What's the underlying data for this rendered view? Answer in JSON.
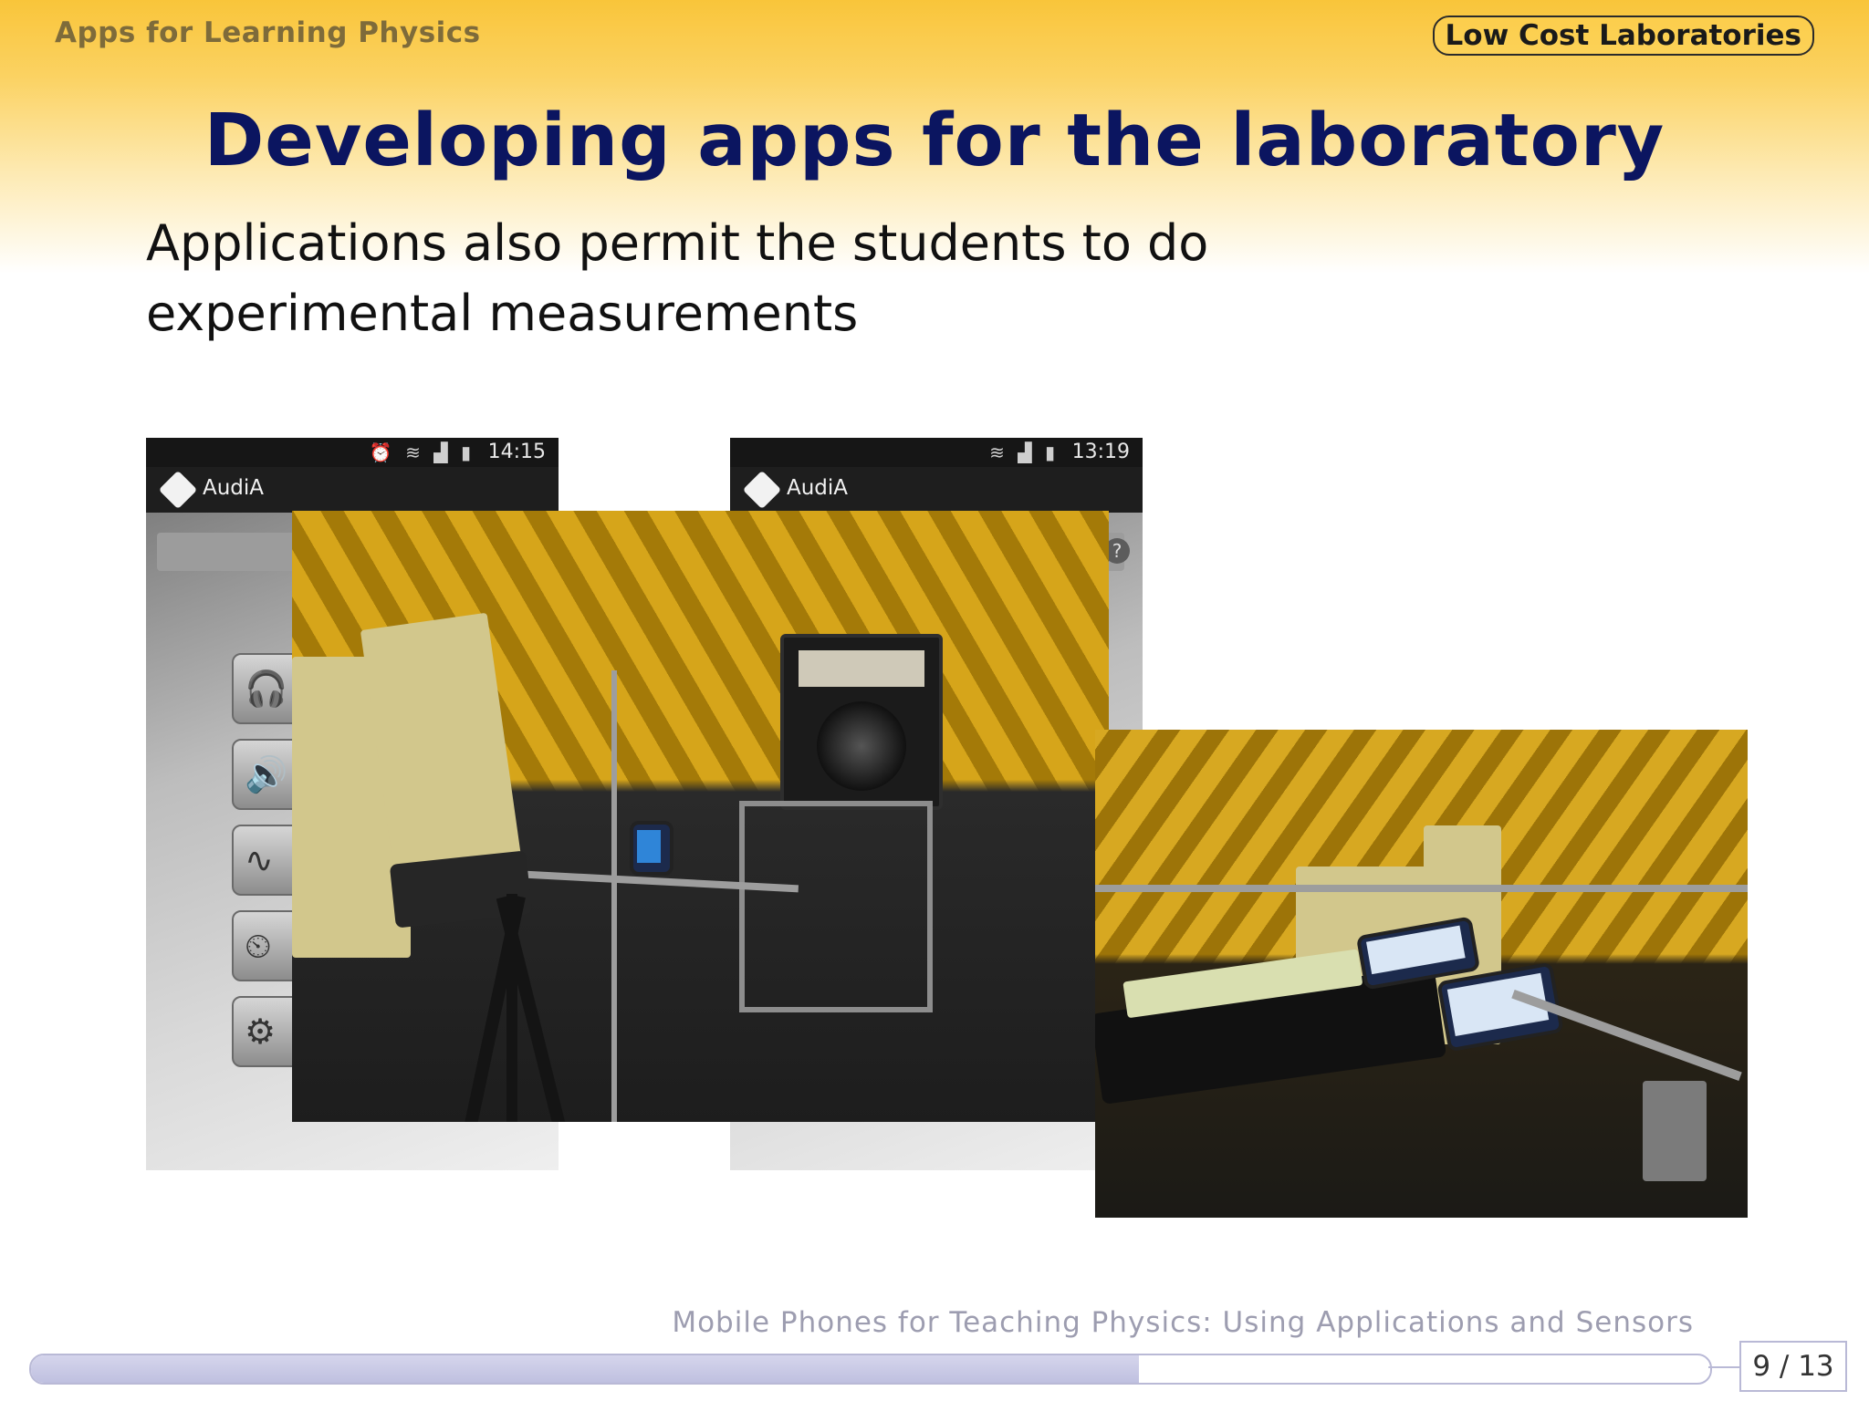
{
  "header": {
    "section_left": "Apps for Learning Physics",
    "section_right": "Low Cost Laboratories"
  },
  "slide": {
    "title": "Developing apps for the laboratory",
    "body": "Applications also permit the students to do experimental measurements"
  },
  "screenshots": [
    {
      "app_name": "AudiA",
      "time": "14:15",
      "status_icons": [
        "alarm-icon",
        "wifi-icon",
        "signal-icon",
        "battery-icon"
      ],
      "menu_icons": [
        "headphones-icon",
        "speakers-icon",
        "waveform-icon",
        "clock-icon",
        "gear-icon"
      ]
    },
    {
      "app_name": "AudiA",
      "time": "13:19",
      "status_icons": [
        "wifi-icon",
        "signal-icon",
        "battery-icon"
      ],
      "help_icon": "?"
    }
  ],
  "photos": [
    "anechoic-chamber-speaker-setup-photo",
    "anechoic-chamber-phones-on-rail-photo"
  ],
  "colors": {
    "header_gradient_top": "#f9c53a",
    "title": "#0b1560",
    "footer_text": "#9d9db0"
  },
  "footer": {
    "presentation_title": "Mobile Phones for Teaching Physics: Using Applications and Sensors",
    "page": "9 / 13",
    "progress_fraction": 0.66
  }
}
